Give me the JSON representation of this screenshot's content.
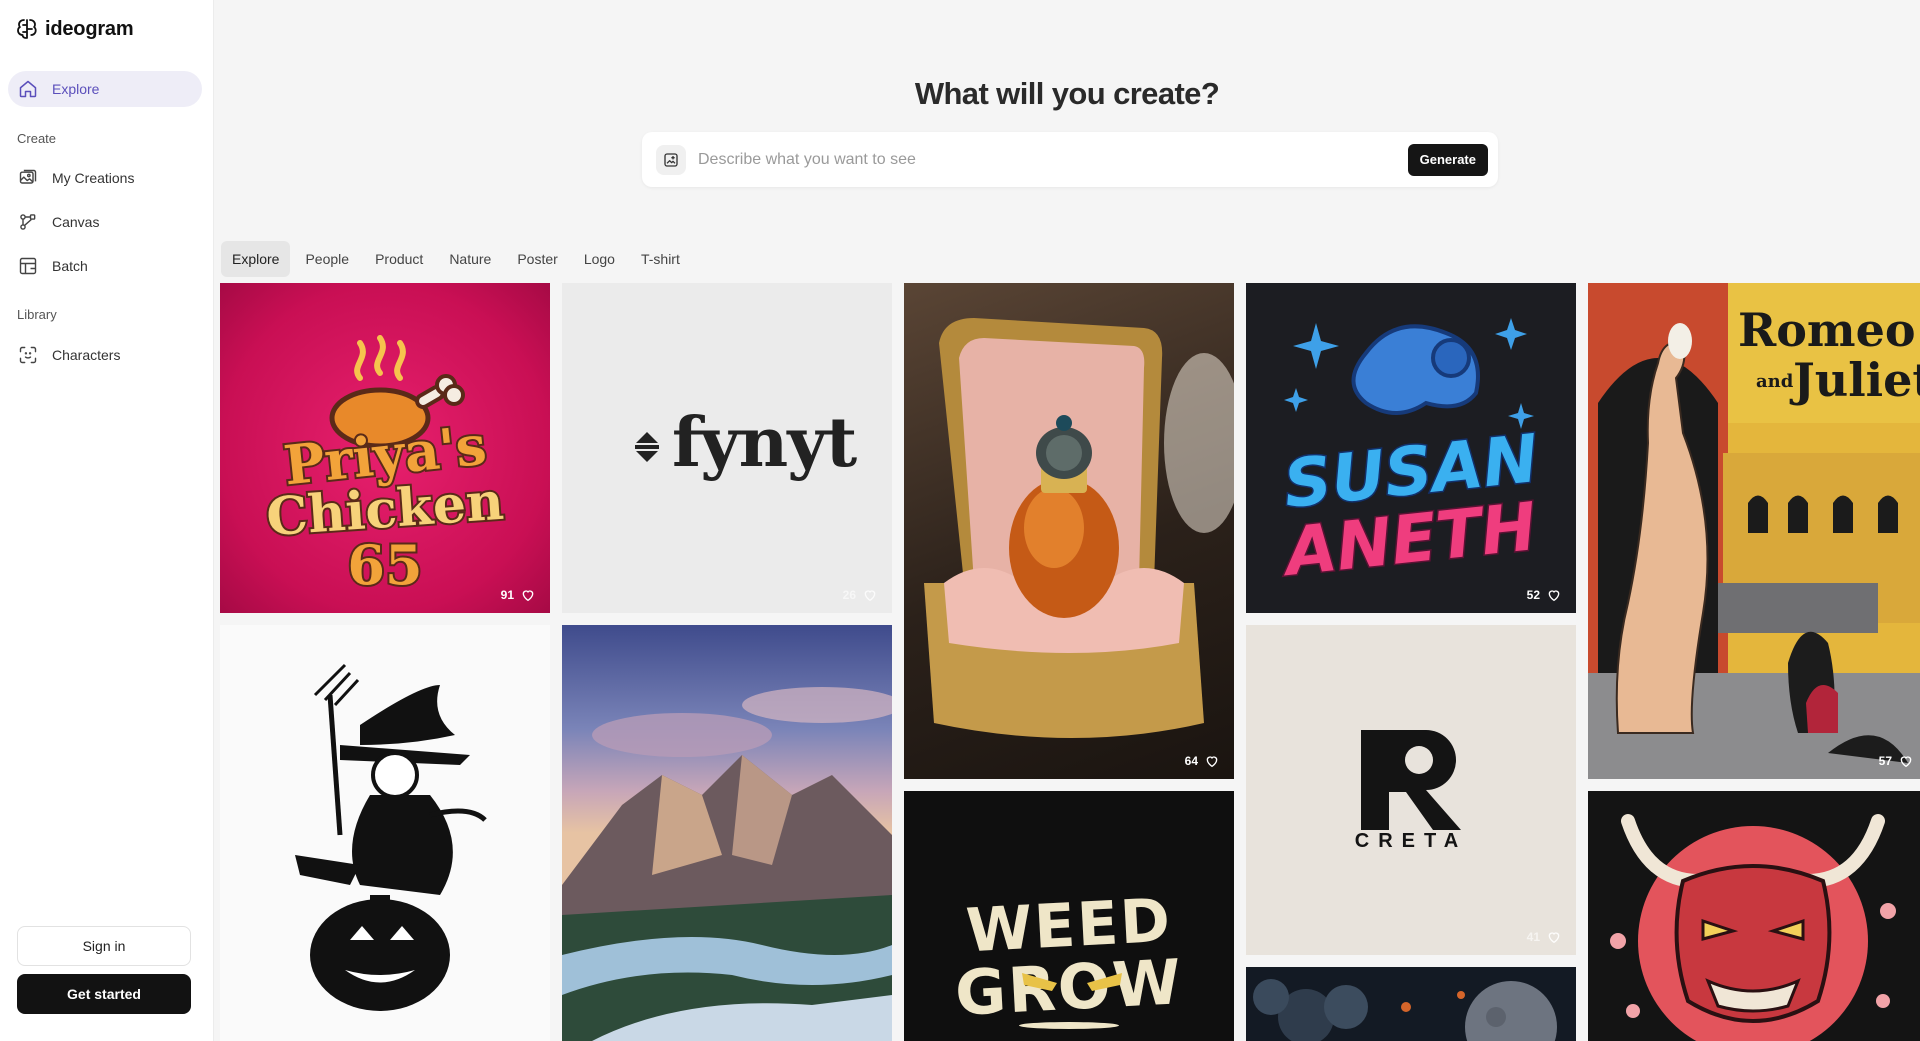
{
  "app": {
    "name": "ideogram"
  },
  "sidebar": {
    "explore": "Explore",
    "create_label": "Create",
    "create_items": [
      "My Creations",
      "Canvas",
      "Batch"
    ],
    "library_label": "Library",
    "library_items": [
      "Characters"
    ],
    "sign_in": "Sign in",
    "get_started": "Get started"
  },
  "main": {
    "headline": "What will you create?",
    "prompt": {
      "placeholder": "Describe what you want to see",
      "generate": "Generate"
    },
    "tabs": [
      "Explore",
      "People",
      "Product",
      "Nature",
      "Poster",
      "Logo",
      "T-shirt"
    ]
  },
  "gallery": [
    {
      "subject": "Priya's Chicken 65 logo",
      "text": [
        "Priya's",
        "Chicken",
        "65"
      ],
      "likes": "91"
    },
    {
      "subject": "fynyt wordmark logo",
      "text": [
        "fynyt"
      ],
      "likes": "26"
    },
    {
      "subject": "Perfume bottle in gold box",
      "likes": "64"
    },
    {
      "subject": "Susan Aneth graffiti",
      "text": [
        "SUSAN",
        "ANETH"
      ],
      "likes": "52"
    },
    {
      "subject": "Romeo and Juliet poster",
      "text": [
        "Romeo",
        "and",
        "Juliet"
      ],
      "likes": "57"
    },
    {
      "subject": "Witch on pumpkin"
    },
    {
      "subject": "Mountain river landscape"
    },
    {
      "subject": "Weed Grow logo",
      "text": [
        "WEED",
        "GROW"
      ]
    },
    {
      "subject": "Creta logo",
      "text": [
        "CRETA"
      ],
      "likes": "41"
    },
    {
      "subject": "Night flowers and moon"
    },
    {
      "subject": "Red oni mask"
    }
  ],
  "colors": {
    "accent": "#5b4fbb",
    "dark": "#121212"
  }
}
